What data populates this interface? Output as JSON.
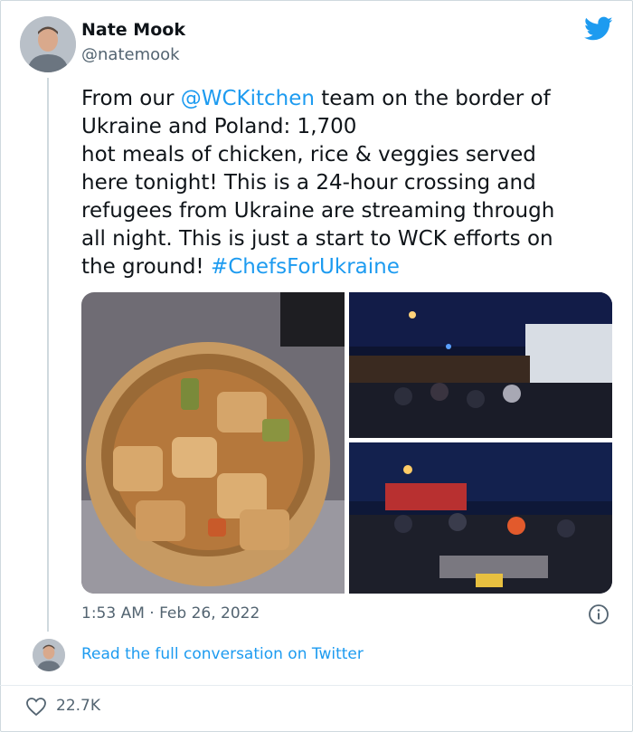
{
  "author": {
    "name": "Nate Mook",
    "handle": "@natemook",
    "avatar_icon": "person-avatar"
  },
  "brand": {
    "icon": "twitter-bird-icon",
    "color": "#1d9bf0"
  },
  "tweet": {
    "line1_pre": "From our ",
    "mention": "@WCKitchen",
    "line1_post": " team on the border of",
    "line2": "Ukraine and Poland: 1,700",
    "line3": "hot meals of chicken, rice & veggies served",
    "line4": "here tonight! This is a 24-hour crossing and",
    "line5": "refugees from Ukraine are streaming through",
    "line6": "all night. This is just a start to WCK efforts on",
    "line7_pre": "the ground! ",
    "hashtag": "#ChefsForUkraine"
  },
  "media": [
    {
      "subject": "bowl of chicken, rice and vegetable stew"
    },
    {
      "subject": "night scene of people gathered near a food truck"
    },
    {
      "subject": "night scene of volunteers serving food at border crossing"
    }
  ],
  "meta": {
    "timestamp": "1:53 AM · Feb 26, 2022",
    "info_icon": "info-icon"
  },
  "conversation": {
    "link_text": "Read the full conversation on Twitter"
  },
  "engagement": {
    "likes": "22.7K",
    "like_icon": "heart-icon"
  }
}
